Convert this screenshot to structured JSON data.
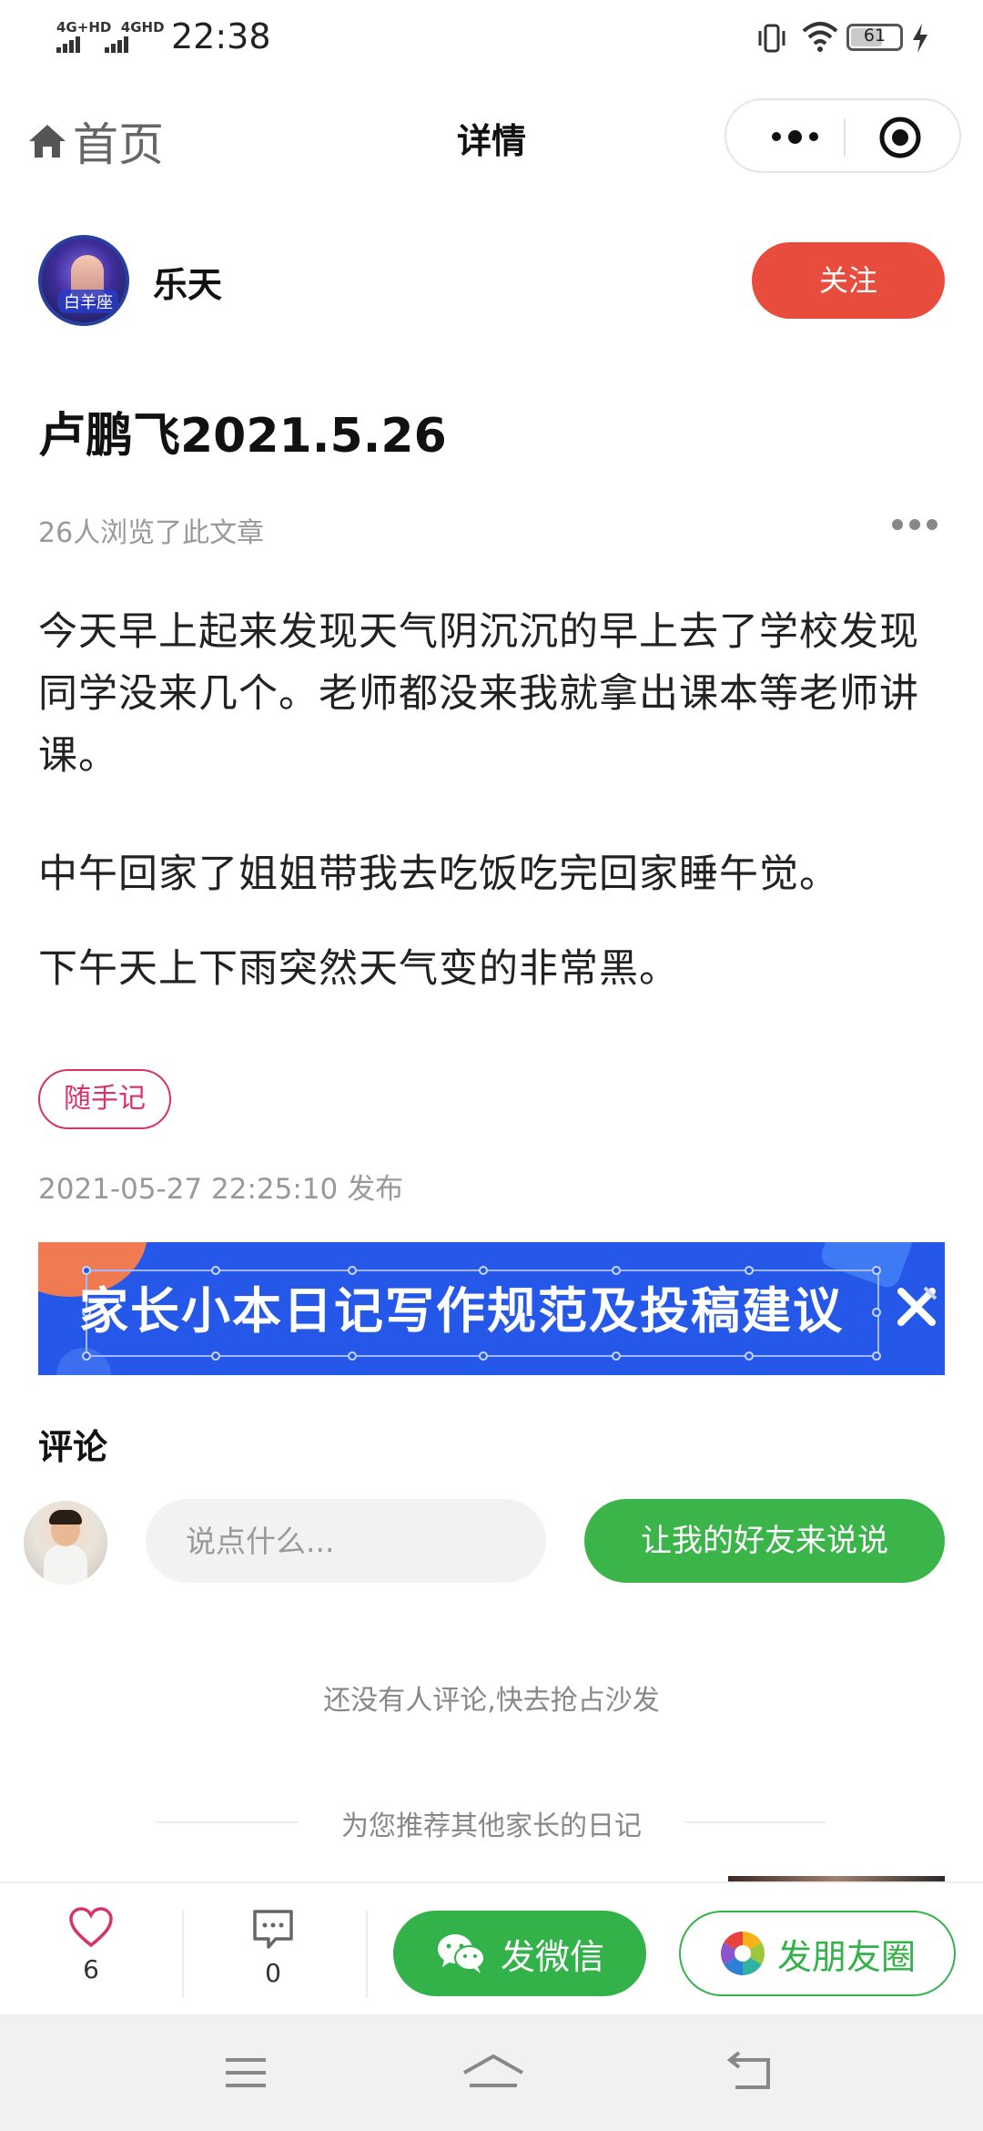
{
  "status_bar": {
    "network1": "4G+HD",
    "network2": "4GHD",
    "time": "22:38",
    "battery": "61"
  },
  "nav": {
    "home_label": "首页",
    "title": "详情"
  },
  "author": {
    "name": "乐天",
    "avatar_tag": "白羊座",
    "follow_label": "关注"
  },
  "article": {
    "title": "卢鹏飞2021.5.26",
    "views": "26人浏览了此文章",
    "paragraphs": [
      "今天早上起来发现天气阴沉沉的早上去了学校发现同学没来几个。老师都没来我就拿出课本等老师讲课。",
      "中午回家了姐姐带我去吃饭吃完回家睡午觉。",
      "下午天上下雨突然天气变的非常黑。"
    ],
    "tag": "随手记",
    "published": "2021-05-27 22:25:10 发布"
  },
  "banner": {
    "text": "家长小本日记写作规范及投稿建议"
  },
  "comments": {
    "title": "评论",
    "input_placeholder": "说点什么...",
    "friend_button": "让我的好友来说说",
    "empty_text": "还没有人评论,快去抢占沙发"
  },
  "recommend": {
    "label": "为您推荐其他家长的日记"
  },
  "action_bar": {
    "likes": "6",
    "comments": "0",
    "wechat_label": "发微信",
    "moments_label": "发朋友圈"
  },
  "colors": {
    "follow": "#e84c3d",
    "green": "#34b24a",
    "tag": "#d6336c",
    "banner": "#2557e8"
  }
}
